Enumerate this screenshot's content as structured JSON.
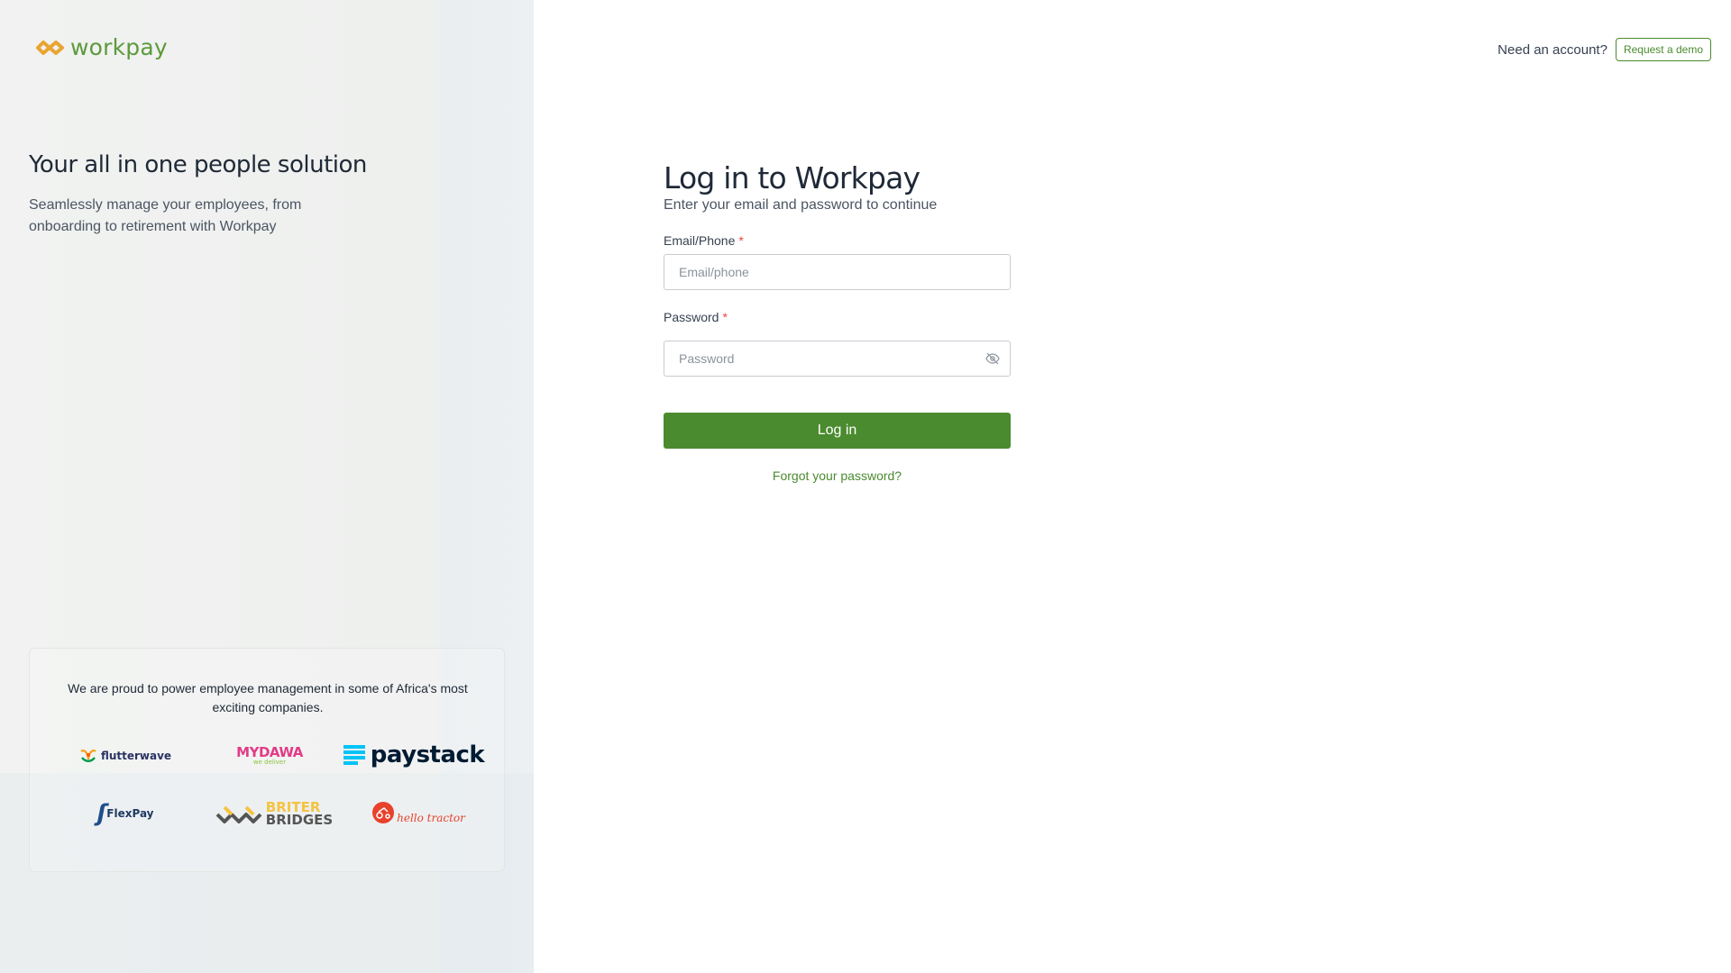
{
  "brand": {
    "name": "workpay",
    "accent": "#4a8b2f",
    "logo_color": "#e8a531"
  },
  "hero": {
    "title": "Your all in one people solution",
    "subtitle": "Seamlessly manage your employees, from onboarding to retirement with Workpay"
  },
  "clients": {
    "text": "We are proud to power employee management in some of Africa's most exciting companies.",
    "logos": [
      {
        "name": "flutterwave"
      },
      {
        "name": "MYDAWA",
        "tagline": "we deliver"
      },
      {
        "name": "paystack"
      },
      {
        "name": "FlexPay"
      },
      {
        "name": "BRITER",
        "name2": "BRIDGES"
      },
      {
        "name": "hello tractor"
      }
    ]
  },
  "header": {
    "need_account": "Need an account?",
    "demo_label": "Request a demo"
  },
  "form": {
    "title": "Log in to Workpay",
    "subtitle": "Enter your email and password to continue",
    "email_label": "Email/Phone",
    "email_placeholder": "Email/phone",
    "password_label": "Password",
    "password_placeholder": "Password",
    "required_mark": "*",
    "login_label": "Log in",
    "forgot_label": "Forgot your password?"
  }
}
